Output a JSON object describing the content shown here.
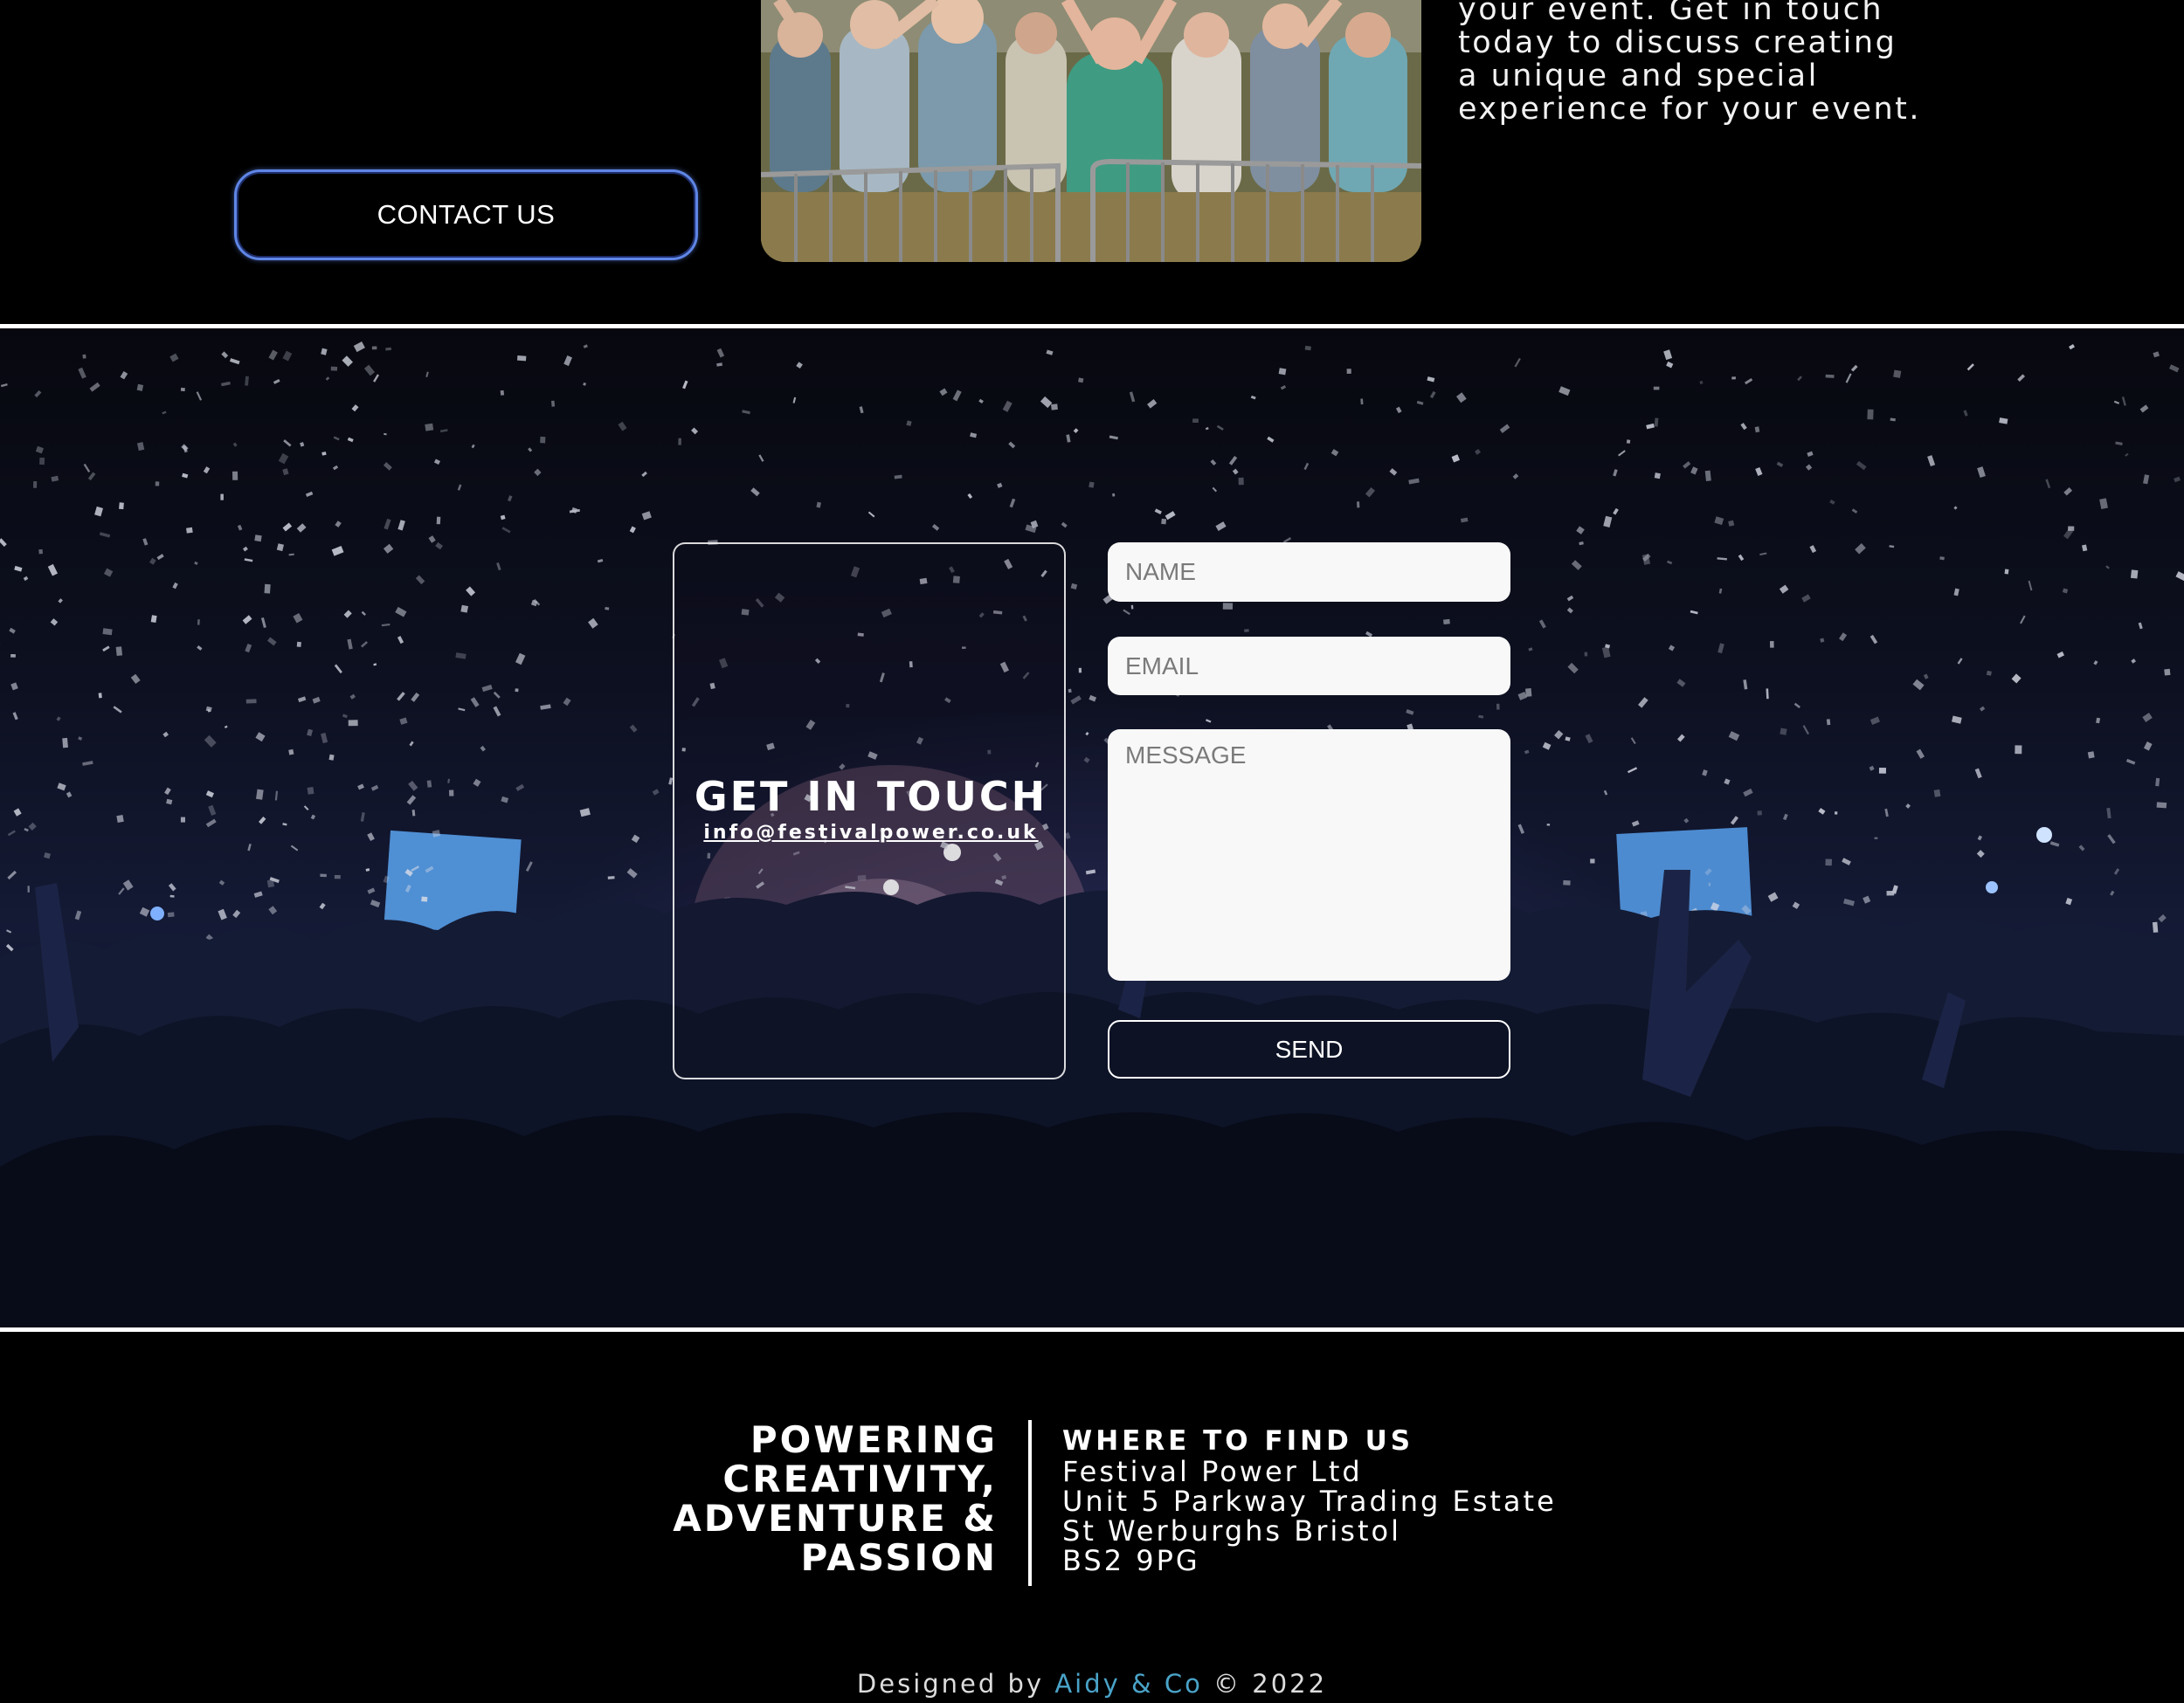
{
  "top": {
    "contact_button_label": "CONTACT US",
    "intro_lines": [
      "your event. Get in touch",
      "today to discuss creating",
      "a unique and special",
      "experience for your event."
    ]
  },
  "contact": {
    "title": "GET IN TOUCH",
    "email": "info@festivalpower.co.uk",
    "form": {
      "name_placeholder": "NAME",
      "email_placeholder": "EMAIL",
      "message_placeholder": "MESSAGE",
      "send_label": "SEND"
    }
  },
  "footer": {
    "slogan_lines": [
      "POWERING",
      "CREATIVITY,",
      "ADVENTURE &",
      "PASSION"
    ],
    "find_us_title": "WHERE TO FIND US",
    "address_lines": [
      "Festival Power Ltd",
      "Unit 5 Parkway Trading Estate",
      "St Werburghs Bristol",
      "BS2 9PG"
    ],
    "credit_prefix": "Designed by",
    "credit_studio": "Aidy & Co",
    "credit_suffix": "© 2022"
  },
  "colors": {
    "accent_border": "#5f86e6",
    "credit_link": "#4aa3c8",
    "background": "#000000"
  }
}
